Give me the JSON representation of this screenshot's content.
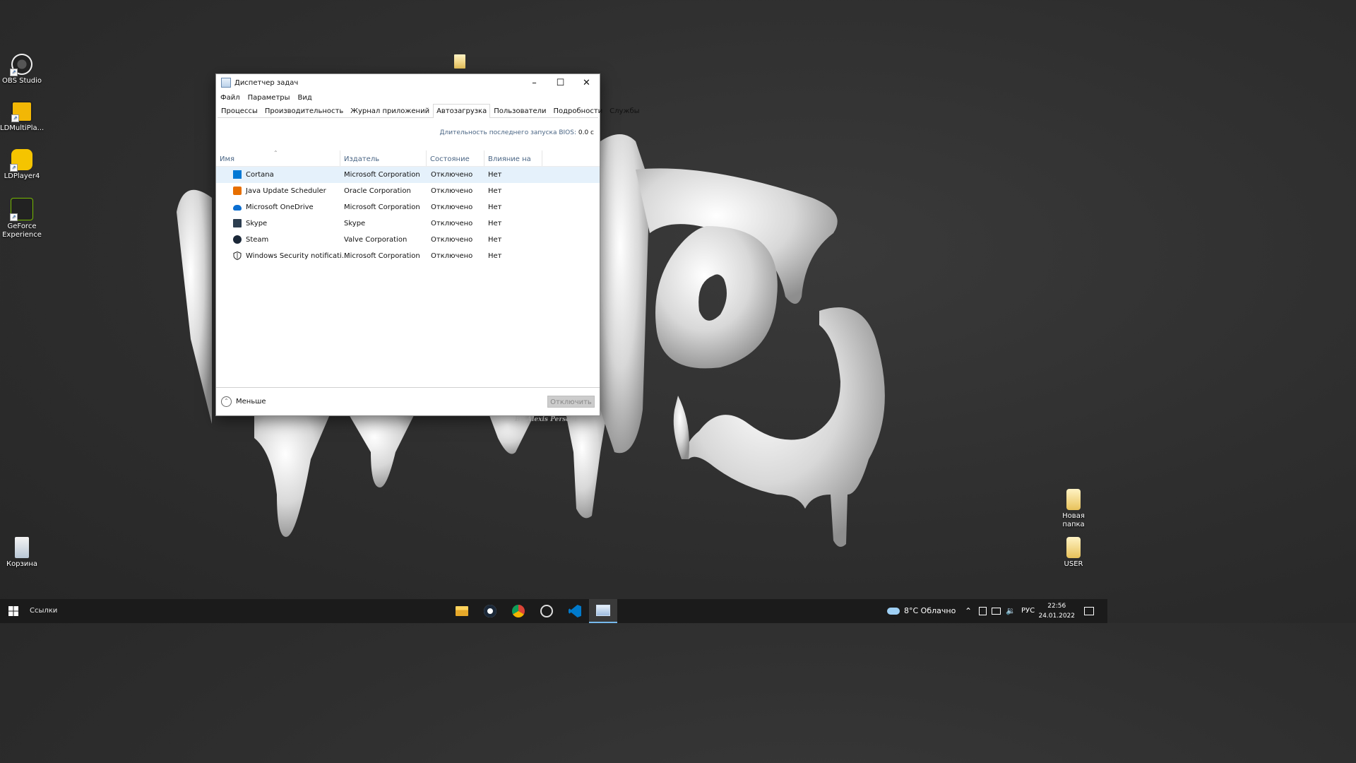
{
  "desktop": {
    "icons_left": [
      {
        "label": "OBS Studio"
      },
      {
        "label": "LDMultiPla..."
      },
      {
        "label": "LDPlayer4"
      },
      {
        "label": "GeForce Experience"
      },
      {
        "label": "Корзина"
      }
    ],
    "icons_right": [
      {
        "label": "Новая папка"
      },
      {
        "label": "USER"
      }
    ],
    "wallpaper_signature": "BY Alexis Persani"
  },
  "window": {
    "title": "Диспетчер задач",
    "menu": [
      "Файл",
      "Параметры",
      "Вид"
    ],
    "tabs": [
      "Процессы",
      "Производительность",
      "Журнал приложений",
      "Автозагрузка",
      "Пользователи",
      "Подробности",
      "Службы"
    ],
    "active_tab": "Автозагрузка",
    "bios_label": "Длительность последнего запуска BIOS:",
    "bios_value": "0.0 с",
    "columns": [
      "Имя",
      "Издатель",
      "Состояние",
      "Влияние на за..."
    ],
    "rows": [
      {
        "name": "Cortana",
        "publisher": "Microsoft Corporation",
        "status": "Отключено",
        "impact": "Нет",
        "icon": "cortana-icon"
      },
      {
        "name": "Java Update Scheduler",
        "publisher": "Oracle Corporation",
        "status": "Отключено",
        "impact": "Нет",
        "icon": "java-icon"
      },
      {
        "name": "Microsoft OneDrive",
        "publisher": "Microsoft Corporation",
        "status": "Отключено",
        "impact": "Нет",
        "icon": "onedrive-icon"
      },
      {
        "name": "Skype",
        "publisher": "Skype",
        "status": "Отключено",
        "impact": "Нет",
        "icon": "skype-icon"
      },
      {
        "name": "Steam",
        "publisher": "Valve Corporation",
        "status": "Отключено",
        "impact": "Нет",
        "icon": "steam-icon"
      },
      {
        "name": "Windows Security notificati...",
        "publisher": "Microsoft Corporation",
        "status": "Отключено",
        "impact": "Нет",
        "icon": "shield-icon"
      }
    ],
    "less_label": "Меньше",
    "disable_label": "Отключить"
  },
  "taskbar": {
    "links_label": "Ссылки",
    "weather": "8°C  Облачно",
    "language": "РУС",
    "time": "22:56",
    "date": "24.01.2022",
    "apps": [
      "file-explorer-icon",
      "steam-icon",
      "chrome-icon",
      "obs-icon",
      "vscode-icon",
      "task-manager-icon"
    ],
    "colors": {
      "accent": "#76b9ed",
      "bar": "#1b1b1b"
    }
  }
}
